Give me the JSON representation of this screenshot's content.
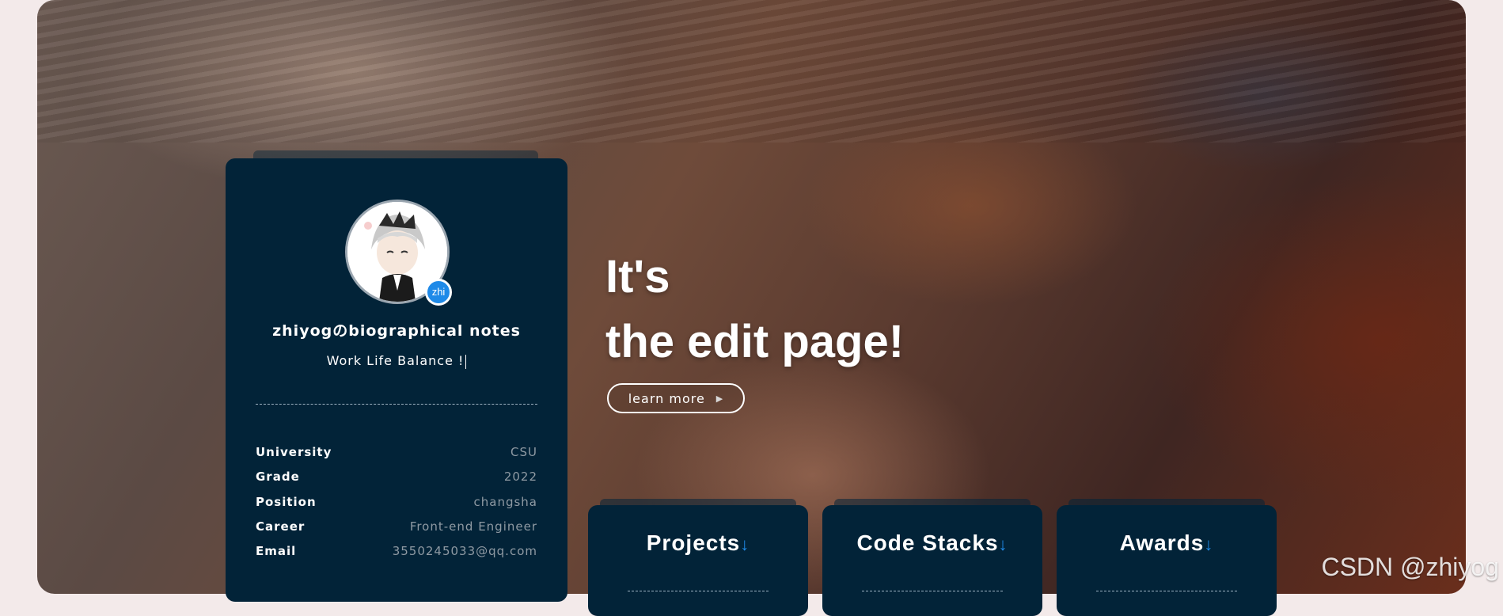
{
  "profile": {
    "title": "zhiyogのbiographical notes",
    "motto": "Work Life Balance !",
    "badge": "zhi",
    "info": [
      {
        "label": "University",
        "value": "CSU"
      },
      {
        "label": "Grade",
        "value": "2022"
      },
      {
        "label": "Position",
        "value": "changsha"
      },
      {
        "label": "Career",
        "value": "Front-end Engineer"
      },
      {
        "label": "Email",
        "value": "3550245033@qq.com"
      }
    ]
  },
  "hero": {
    "line1": "It's",
    "line2": "the edit page!",
    "button_label": "learn more",
    "button_icon": "play-triangle-icon"
  },
  "cards": [
    {
      "title": "Projects",
      "arrow": "↓"
    },
    {
      "title": "Code Stacks",
      "arrow": "↓"
    },
    {
      "title": "Awards",
      "arrow": "↓"
    }
  ],
  "watermark": "CSDN @zhiyog",
  "colors": {
    "panel": "#022338",
    "accent": "#1f8ae8",
    "page_bg": "#f3eaea"
  }
}
